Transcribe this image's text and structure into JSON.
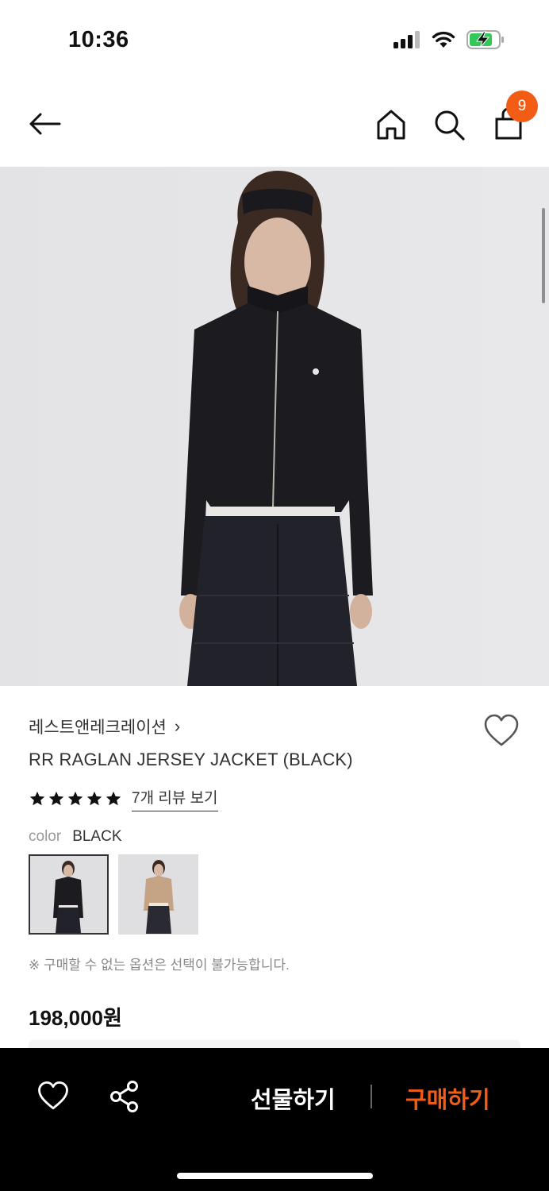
{
  "status_bar": {
    "time": "10:36",
    "battery_color": "#34c759"
  },
  "nav": {
    "cart_count": "9",
    "badge_color": "#f25c14"
  },
  "product": {
    "brand": "레스트앤레크레이션",
    "brand_chevron": "›",
    "name": "RR RAGLAN JERSEY JACKET (BLACK)",
    "rating_stars": 5,
    "review_link": "7개 리뷰 보기",
    "color_label": "color",
    "color_value": "BLACK",
    "swatches": [
      "black-jacket",
      "beige-jacket"
    ],
    "option_note": "※ 구매할 수 없는 옵션은 선택이 불가능합니다.",
    "price": "198,000원"
  },
  "bottom_bar": {
    "gift_label": "선물하기",
    "buy_label": "구매하기",
    "buy_color": "#f25c14"
  },
  "icons": [
    "back-arrow-icon",
    "home-icon",
    "search-icon",
    "shopping-bag-icon",
    "heart-icon",
    "share-icon",
    "star-icon"
  ]
}
